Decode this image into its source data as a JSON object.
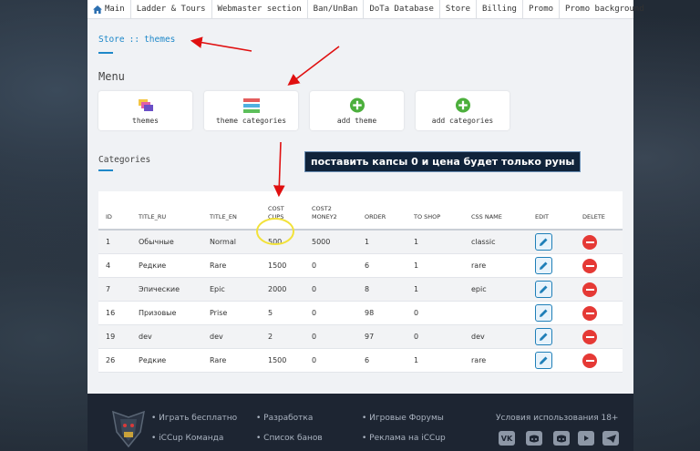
{
  "nav": {
    "items": [
      "Main",
      "Ladder & Tours",
      "Webmaster section",
      "Ban/UnBan",
      "DoTa Database",
      "Store",
      "Billing",
      "Promo",
      "Promo background"
    ]
  },
  "breadcrumb": {
    "part1": "Store",
    "separator": "::",
    "part2": "themes"
  },
  "menu": {
    "title": "Menu",
    "cards": [
      {
        "label": "themes",
        "icon": "stacked-layers-icon"
      },
      {
        "label": "theme categories",
        "icon": "category-bars-icon"
      },
      {
        "label": "add theme",
        "icon": "plus-circle-icon"
      },
      {
        "label": "add categories",
        "icon": "plus-circle-icon"
      }
    ]
  },
  "categories": {
    "title": "Categories",
    "headers": {
      "id": "ID",
      "title_ru": "TITLE_RU",
      "title_en": "TITLE_EN",
      "cost_cups_1": "COST",
      "cost_cups_2": "CUPS",
      "cost_money_1": "COST2",
      "cost_money_2": "MONEY2",
      "order": "ORDER",
      "to_shop": "TO SHOP",
      "css_name": "CSS NAME",
      "edit": "EDIT",
      "delete": "DELETE"
    },
    "rows": [
      {
        "id": "1",
        "title_ru": "Обычные",
        "title_en": "Normal",
        "cost_cups": "500",
        "cost_money2": "5000",
        "order": "1",
        "to_shop": "1",
        "css_name": "classic"
      },
      {
        "id": "4",
        "title_ru": "Редкие",
        "title_en": "Rare",
        "cost_cups": "1500",
        "cost_money2": "0",
        "order": "6",
        "to_shop": "1",
        "css_name": "rare"
      },
      {
        "id": "7",
        "title_ru": "Эпические",
        "title_en": "Epic",
        "cost_cups": "2000",
        "cost_money2": "0",
        "order": "8",
        "to_shop": "1",
        "css_name": "epic"
      },
      {
        "id": "16",
        "title_ru": "Призовые",
        "title_en": "Prise",
        "cost_cups": "5",
        "cost_money2": "0",
        "order": "98",
        "to_shop": "0",
        "css_name": ""
      },
      {
        "id": "19",
        "title_ru": "dev",
        "title_en": "dev",
        "cost_cups": "2",
        "cost_money2": "0",
        "order": "97",
        "to_shop": "0",
        "css_name": "dev"
      },
      {
        "id": "26",
        "title_ru": "Редкие",
        "title_en": "Rare",
        "cost_cups": "1500",
        "cost_money2": "0",
        "order": "6",
        "to_shop": "1",
        "css_name": "rare"
      }
    ]
  },
  "annotation": {
    "text": "поставить капсы 0 и цена будет только руны",
    "color": "#e01010"
  },
  "footer": {
    "col1": [
      "Играть бесплатно",
      "iCCup Команда"
    ],
    "col2": [
      "Разработка",
      "Список банов"
    ],
    "col3": [
      "Игровые Форумы",
      "Реклама на iCCup"
    ],
    "terms": "Условия использования 18+",
    "social": [
      "vk-icon",
      "discord-icon",
      "discord-icon",
      "youtube-icon",
      "telegram-icon"
    ]
  },
  "colors": {
    "accent": "#1e88c9",
    "delete": "#e53935",
    "annotation_bg": "#10233a"
  }
}
